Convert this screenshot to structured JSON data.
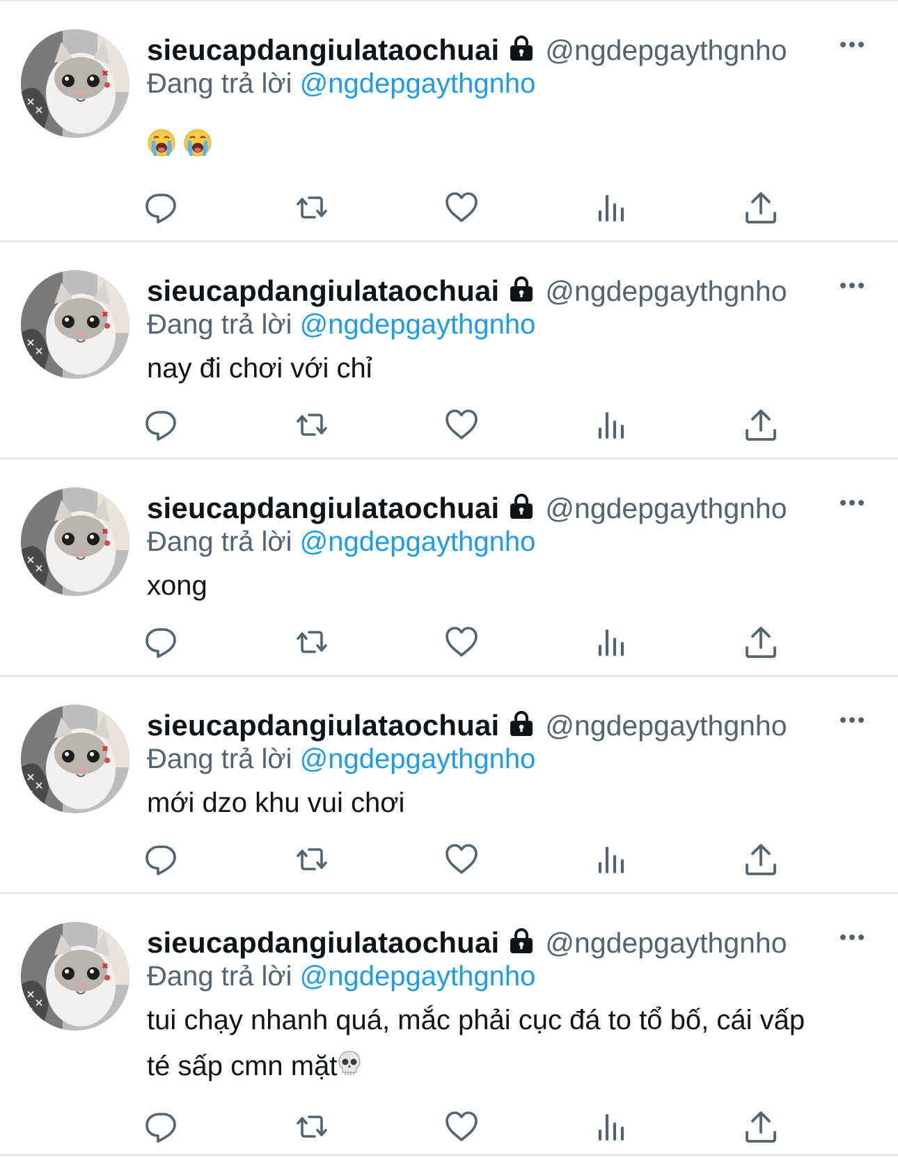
{
  "tweets": [
    {
      "name": "sieucapdangiulataochuai",
      "handle": "@ngdepgaythgnho",
      "reply_prefix": "Đang trả lời",
      "reply_to": "@ngdepgaythgnho",
      "text": "",
      "emojis": [
        "loudly-crying-face",
        "loudly-crying-face"
      ]
    },
    {
      "name": "sieucapdangiulataochuai",
      "handle": "@ngdepgaythgnho",
      "reply_prefix": "Đang trả lời",
      "reply_to": "@ngdepgaythgnho",
      "text": "nay đi chơi với chỉ",
      "emojis": []
    },
    {
      "name": "sieucapdangiulataochuai",
      "handle": "@ngdepgaythgnho",
      "reply_prefix": "Đang trả lời",
      "reply_to": "@ngdepgaythgnho",
      "text": "xong",
      "emojis": []
    },
    {
      "name": "sieucapdangiulataochuai",
      "handle": "@ngdepgaythgnho",
      "reply_prefix": "Đang trả lời",
      "reply_to": "@ngdepgaythgnho",
      "text": "mới dzo khu vui chơi",
      "emojis": []
    },
    {
      "name": "sieucapdangiulataochuai",
      "handle": "@ngdepgaythgnho",
      "reply_prefix": "Đang trả lời",
      "reply_to": "@ngdepgaythgnho",
      "text": "tui chạy nhanh quá, mắc phải cục đá to tổ bố, cái vấp té sấp cmn mặt",
      "emojis": [
        "skull"
      ]
    }
  ],
  "icons": {
    "lock": "lock-icon",
    "more": "more-options-icon",
    "actions": [
      "reply-icon",
      "retweet-icon",
      "like-icon",
      "views-icon",
      "share-icon"
    ]
  },
  "colors": {
    "text": "#0f1419",
    "secondary": "#536471",
    "link": "#1d9bf0",
    "divider": "#e4e6e8"
  }
}
